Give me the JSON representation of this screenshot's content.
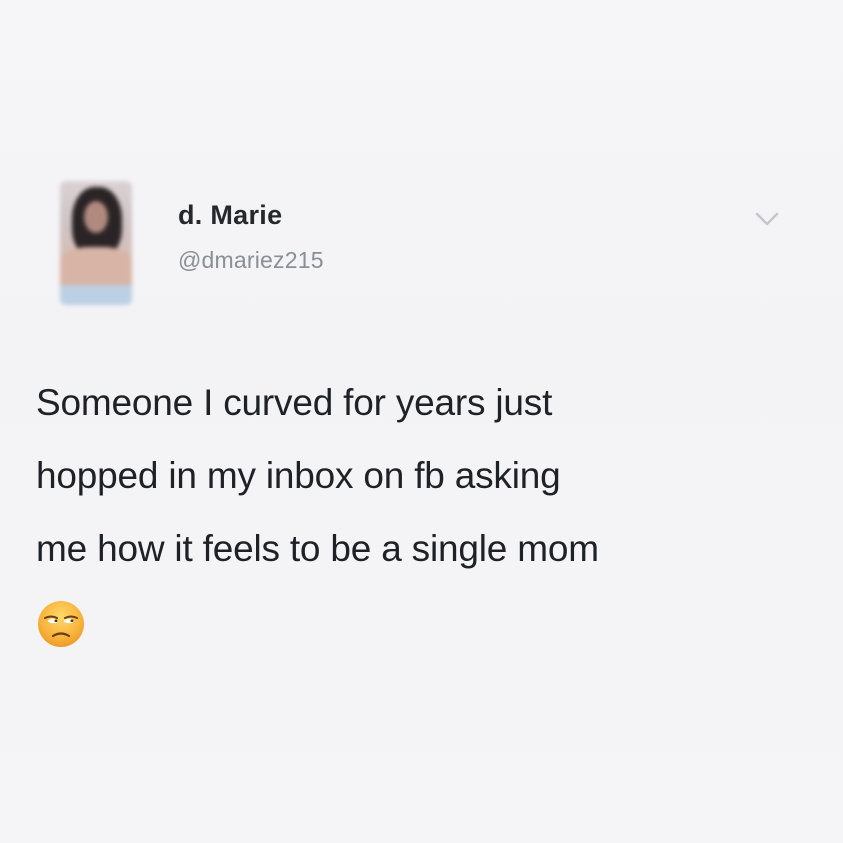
{
  "tweet": {
    "display_name": "d. Marie",
    "handle": "@dmariez215",
    "text_lines": [
      "Someone I curved for years just",
      "hopped in my inbox on fb asking",
      "me how it feels to be a single mom"
    ],
    "emoji": "unamused-face-emoji",
    "menu_icon": "chevron-down-icon"
  },
  "colors": {
    "background": "#f4f4f6",
    "text": "#1f2126",
    "handle": "#8a8f96",
    "chevron": "#c4c7cc"
  }
}
